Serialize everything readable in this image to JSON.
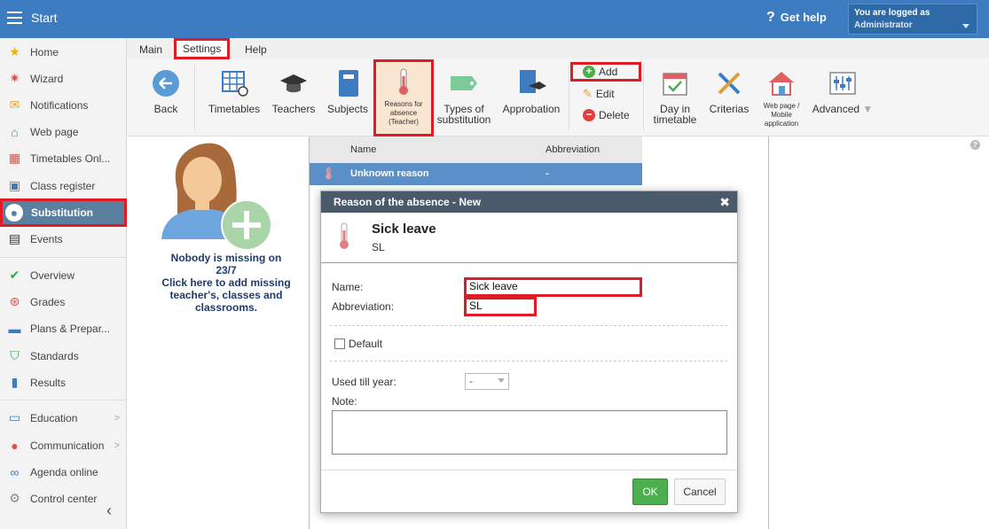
{
  "topbar": {
    "title": "Start",
    "help": "Get help",
    "login_label": "You are logged as",
    "login_user": "Administrator"
  },
  "sidebar": {
    "items": [
      {
        "label": "Home",
        "icon": "star-icon"
      },
      {
        "label": "Wizard",
        "icon": "wand-icon"
      },
      {
        "label": "Notifications",
        "icon": "envelope-icon"
      },
      {
        "label": "Web page",
        "icon": "house-icon"
      },
      {
        "label": "Timetables Onl...",
        "icon": "table-icon"
      },
      {
        "label": "Class register",
        "icon": "register-icon"
      },
      {
        "label": "Substitution",
        "icon": "person-icon"
      },
      {
        "label": "Events",
        "icon": "calendar-icon"
      },
      {
        "label": "Overview",
        "icon": "check-circle-icon"
      },
      {
        "label": "Grades",
        "icon": "grades-icon"
      },
      {
        "label": "Plans & Prepar...",
        "icon": "briefcase-icon"
      },
      {
        "label": "Standards",
        "icon": "shield-icon"
      },
      {
        "label": "Results",
        "icon": "bar-chart-icon"
      },
      {
        "label": "Education",
        "icon": "book-icon"
      },
      {
        "label": "Communication",
        "icon": "chat-icon"
      },
      {
        "label": "Agenda online",
        "icon": "link-icon"
      },
      {
        "label": "Control center",
        "icon": "gear-icon"
      }
    ]
  },
  "tabs": [
    "Main",
    "Settings",
    "Help"
  ],
  "toolbar": {
    "back": "Back",
    "timetables": "Timetables",
    "teachers": "Teachers",
    "subjects": "Subjects",
    "reasons_1": "Reasons for",
    "reasons_2": "absence",
    "reasons_3": "(Teacher)",
    "types_1": "Types of",
    "types_2": "substitution",
    "approbation": "Approbation",
    "add": "Add",
    "edit": "Edit",
    "delete": "Delete",
    "day_1": "Day in",
    "day_2": "timetable",
    "criterias": "Criterias",
    "web_1": "Web page /",
    "web_2": "Mobile",
    "web_3": "application",
    "advanced": "Advanced"
  },
  "missing": {
    "line1": "Nobody is missing on",
    "line2": "23/7",
    "line3": "Click here to add missing",
    "line4": "teacher's, classes and",
    "line5": "classrooms."
  },
  "grid": {
    "col_name": "Name",
    "col_abbr": "Abbreviation",
    "row_name": "Unknown reason",
    "row_abbr": "-"
  },
  "dialog": {
    "header": "Reason of the absence - New",
    "title": "Sick leave",
    "subtitle": "SL",
    "name_label": "Name:",
    "name_value": "Sick leave",
    "abbr_label": "Abbreviation:",
    "abbr_value": "SL",
    "default_label": "Default",
    "used_label": "Used till year:",
    "used_value": "-",
    "note_label": "Note:",
    "ok": "OK",
    "cancel": "Cancel"
  },
  "colors": {
    "topbar": "#3d7cc0",
    "active_nav": "#5b7f9e",
    "highlight": "#e01b24",
    "ok": "#4cae4c",
    "dialog_header": "#4a5a6b"
  }
}
